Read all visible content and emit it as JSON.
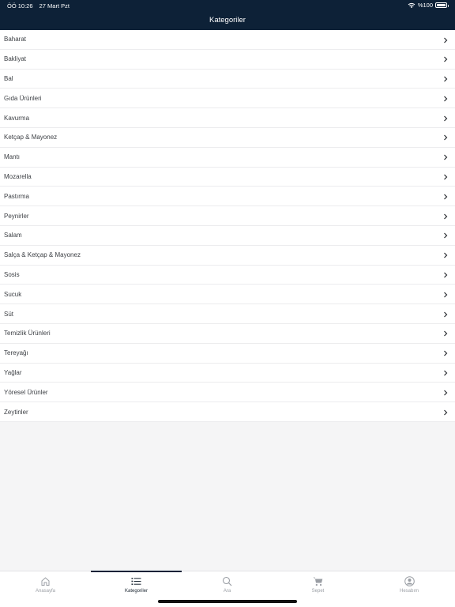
{
  "status_bar": {
    "time": "ÖÖ 10:26",
    "date": "27 Mart Pzt",
    "battery": "%100",
    "wifi_icon": "wifi-icon",
    "battery_level": 1.0
  },
  "header": {
    "title": "Kategoriler"
  },
  "categories": [
    "Baharat",
    "Bakliyat",
    "Bal",
    "Gıda Ürünleri",
    "Kavurma",
    "Ketçap & Mayonez",
    "Mantı",
    "Mozarella",
    "Pastırma",
    "Peynirler",
    "Salam",
    "Salça & Ketçap & Mayonez",
    "Sosis",
    "Sucuk",
    "Süt",
    "Temizlik Ürünleri",
    "Tereyağı",
    "Yağlar",
    "Yöresel Ürünler",
    "Zeytinler"
  ],
  "tabbar": {
    "tabs": [
      {
        "label": "Anasayfa",
        "icon": "home-icon"
      },
      {
        "label": "Kategoriler",
        "icon": "list-icon",
        "active": true
      },
      {
        "label": "Ara",
        "icon": "search-icon"
      },
      {
        "label": "Sepet",
        "icon": "cart-icon"
      },
      {
        "label": "Hesabım",
        "icon": "account-icon"
      }
    ]
  },
  "colors": {
    "header_bg": "#0d2137",
    "background": "#f5f5f6",
    "text": "#3c3f44",
    "inactive_tab": "#9a9ea4"
  }
}
